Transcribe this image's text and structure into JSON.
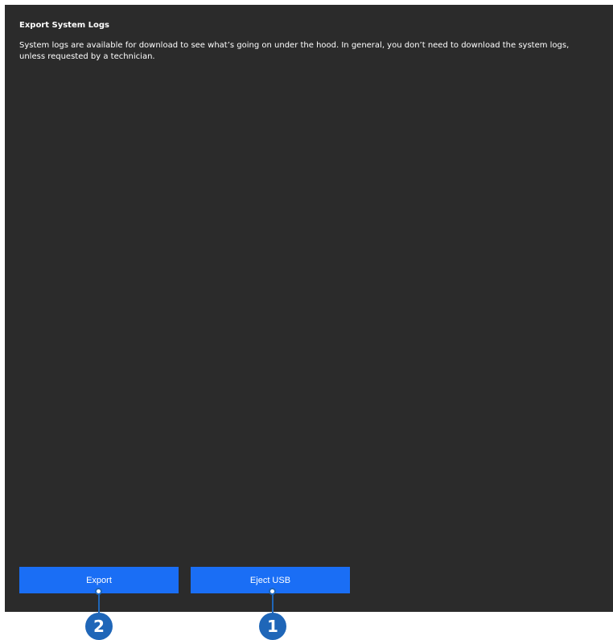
{
  "section": {
    "title": "Export System Logs",
    "description": "System logs are available for download to see what’s going on under the hood. In general, you don’t need to download the system logs, unless requested by a technician."
  },
  "buttons": {
    "export_label": "Export",
    "eject_label": "Eject USB"
  },
  "callouts": {
    "export_number": "2",
    "eject_number": "1"
  },
  "colors": {
    "panel_bg": "#2b2b2b",
    "button_bg": "#1a6ef5",
    "callout": "#1f66b8"
  }
}
